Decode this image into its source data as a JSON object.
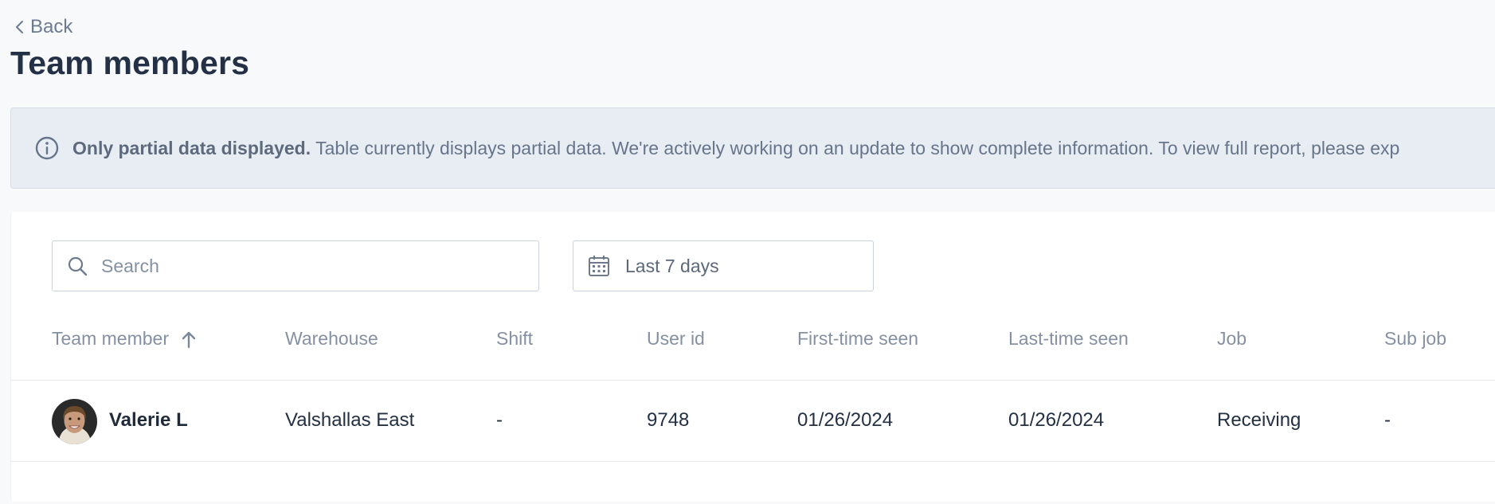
{
  "header": {
    "back_label": "Back",
    "title": "Team members"
  },
  "banner": {
    "bold": "Only partial data displayed.",
    "text": " Table currently displays partial data. We're actively working on an update to show complete information. To view full report, please exp"
  },
  "filters": {
    "search_placeholder": "Search",
    "date_range": "Last 7 days"
  },
  "table": {
    "columns": [
      "Team member",
      "Warehouse",
      "Shift",
      "User id",
      "First-time seen",
      "Last-time seen",
      "Job",
      "Sub job"
    ],
    "rows": [
      {
        "name": "Valerie L",
        "warehouse": "Valshallas East",
        "shift": "-",
        "user_id": "9748",
        "first_seen": "01/26/2024",
        "last_seen": "01/26/2024",
        "job": "Receiving",
        "sub_job": "-"
      }
    ]
  },
  "icons": {
    "back": "chevron-left-icon",
    "info": "info-circle-icon",
    "search": "search-icon",
    "date": "calendar-icon",
    "sort": "arrow-up-icon"
  },
  "colors": {
    "background": "#f7f9fb",
    "banner_bg": "#e8edf4",
    "title": "#233045",
    "muted": "#8591a3"
  }
}
